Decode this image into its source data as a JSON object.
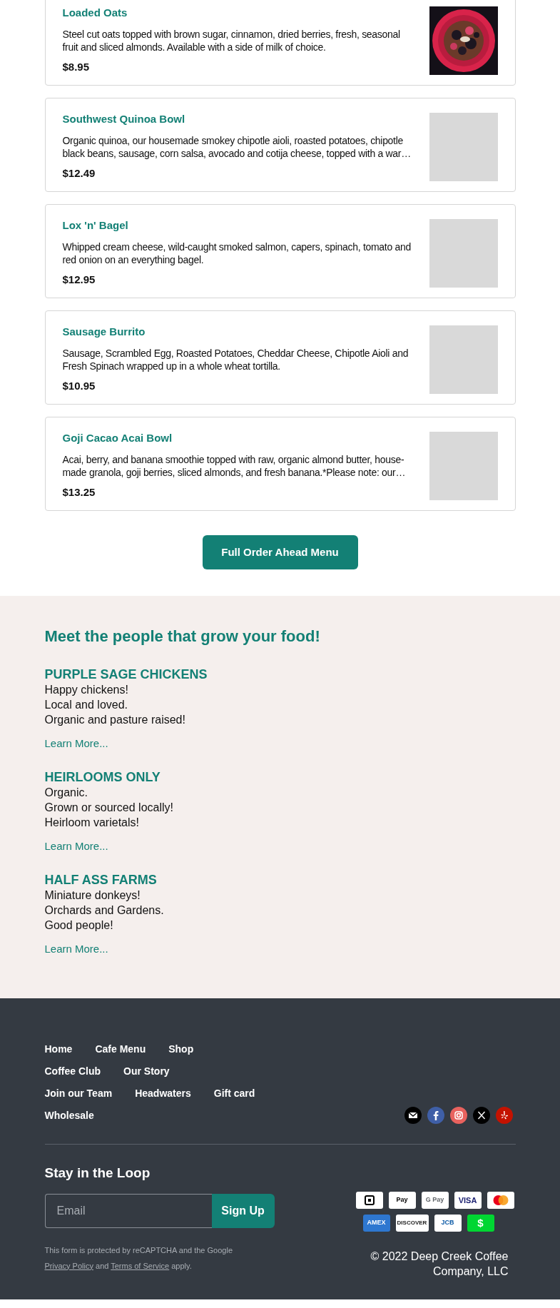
{
  "menu_items": [
    {
      "name": "Loaded Oats",
      "description": "Steel cut oats topped with brown sugar, cinnamon, dried berries, fresh, seasonal fruit and sliced almonds. Available with a side of milk of choice.",
      "price": "$8.95",
      "kind": "picture"
    },
    {
      "name": "Southwest Quinoa Bowl",
      "description": "Organic quinoa, our housemade smokey chipotle aioli, roasted potatoes, chipotle black beans, sausage, corn salsa, avocado and cotija cheese, topped with a war…",
      "price": "$12.49",
      "kind": "placeholder"
    },
    {
      "name": "Lox 'n' Bagel",
      "description": "Whipped cream cheese, wild-caught smoked salmon, capers, spinach, tomato and red onion on an everything bagel.",
      "price": "$12.95",
      "kind": "placeholder"
    },
    {
      "name": "Sausage Burrito",
      "description": "Sausage, Scrambled Egg, Roasted Potatoes, Cheddar Cheese, Chipotle Aioli and Fresh Spinach wrapped up in a whole wheat tortilla.",
      "price": "$10.95",
      "kind": "placeholder"
    },
    {
      "name": "Goji Cacao Acai Bowl",
      "description": "Acai, berry, and banana smoothie topped with raw, organic almond butter, house-made granola, goji berries, sliced almonds, and fresh banana.*Please note: our…",
      "price": "$13.25",
      "kind": "placeholder"
    }
  ],
  "menu_button": "Full Order Ahead Menu",
  "growers": {
    "heading": "Meet the people that grow your food!",
    "farms": [
      {
        "name": "PURPLE SAGE CHICKENS",
        "lines": [
          "Happy chickens!",
          "Local and loved.",
          "Organic and pasture raised!"
        ],
        "link": "Learn More..."
      },
      {
        "name": "HEIRLOOMS ONLY",
        "lines": [
          "Organic.",
          "Grown or sourced locally!",
          "Heirloom varietals!"
        ],
        "link": "Learn More..."
      },
      {
        "name": "HALF ASS FARMS",
        "lines": [
          "Miniature donkeys!",
          "Orchards and Gardens.",
          "Good people!"
        ],
        "link": "Learn More..."
      }
    ]
  },
  "footer": {
    "nav_rows": [
      [
        "Home",
        "Cafe Menu",
        "Shop"
      ],
      [
        "Coffee Club",
        "Our Story"
      ],
      [
        "Join our Team",
        "Headwaters",
        "Gift card"
      ],
      [
        "Wholesale"
      ]
    ],
    "social": [
      {
        "kind": "email"
      },
      {
        "kind": "facebook"
      },
      {
        "kind": "instagram"
      },
      {
        "kind": "x"
      },
      {
        "kind": "yelp"
      }
    ],
    "newsletter": {
      "heading": "Stay in the Loop",
      "placeholder": "Email",
      "button": "Sign Up"
    },
    "recaptcha": {
      "before": "This form is protected by reCAPTCHA and the Google",
      "privacy_link": "Privacy Policy",
      "middle": "and",
      "terms_link": "Terms of Service",
      "after": "apply."
    },
    "payment_rows": [
      [
        {
          "kind": "square"
        },
        {
          "kind": "applepay",
          "label": "Pay"
        },
        {
          "kind": "gpay",
          "label": "G Pay"
        },
        {
          "kind": "visa",
          "label": "VISA"
        },
        {
          "kind": "mastercard"
        }
      ],
      [
        {
          "kind": "amex",
          "label": "AMEX"
        },
        {
          "kind": "discover",
          "label": "DISCOVER"
        },
        {
          "kind": "jcb",
          "label": "JCB"
        },
        {
          "kind": "cashapp",
          "label": "$"
        }
      ]
    ],
    "copyright": "© 2022 Deep Creek Coffee Company, LLC"
  }
}
